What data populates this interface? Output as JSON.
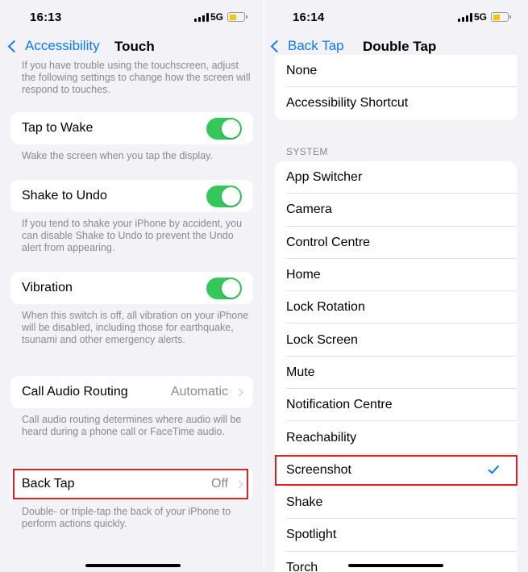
{
  "left": {
    "status": {
      "time": "16:13",
      "network": "5G"
    },
    "nav": {
      "back_label": "Accessibility",
      "title": "Touch"
    },
    "intro_note": "If you have trouble using the touchscreen, adjust the following settings to change how the screen will respond to touches.",
    "tap_to_wake": {
      "label": "Tap to Wake",
      "on": true,
      "note": "Wake the screen when you tap the display."
    },
    "shake_to_undo": {
      "label": "Shake to Undo",
      "on": true,
      "note": "If you tend to shake your iPhone by accident, you can disable Shake to Undo to prevent the Undo alert from appearing."
    },
    "vibration": {
      "label": "Vibration",
      "on": true,
      "note": "When this switch is off, all vibration on your iPhone will be disabled, including those for earthquake, tsunami and other emergency alerts."
    },
    "call_audio_routing": {
      "label": "Call Audio Routing",
      "value": "Automatic",
      "note": "Call audio routing determines where audio will be heard during a phone call or FaceTime audio."
    },
    "back_tap": {
      "label": "Back Tap",
      "value": "Off",
      "note": "Double- or triple-tap the back of your iPhone to perform actions quickly."
    }
  },
  "right": {
    "status": {
      "time": "16:14",
      "network": "5G"
    },
    "nav": {
      "back_label": "Back Tap",
      "title": "Double Tap"
    },
    "top_items": [
      "None",
      "Accessibility Shortcut"
    ],
    "system_header": "SYSTEM",
    "system_items": [
      "App Switcher",
      "Camera",
      "Control Centre",
      "Home",
      "Lock Rotation",
      "Lock Screen",
      "Mute",
      "Notification Centre",
      "Reachability",
      "Screenshot",
      "Shake",
      "Spotlight",
      "Torch"
    ],
    "selected": "Screenshot"
  },
  "colors": {
    "accent": "#0a7aff",
    "toggle_on": "#34c759",
    "highlight": "#e02020",
    "battery": "#f7c600"
  }
}
